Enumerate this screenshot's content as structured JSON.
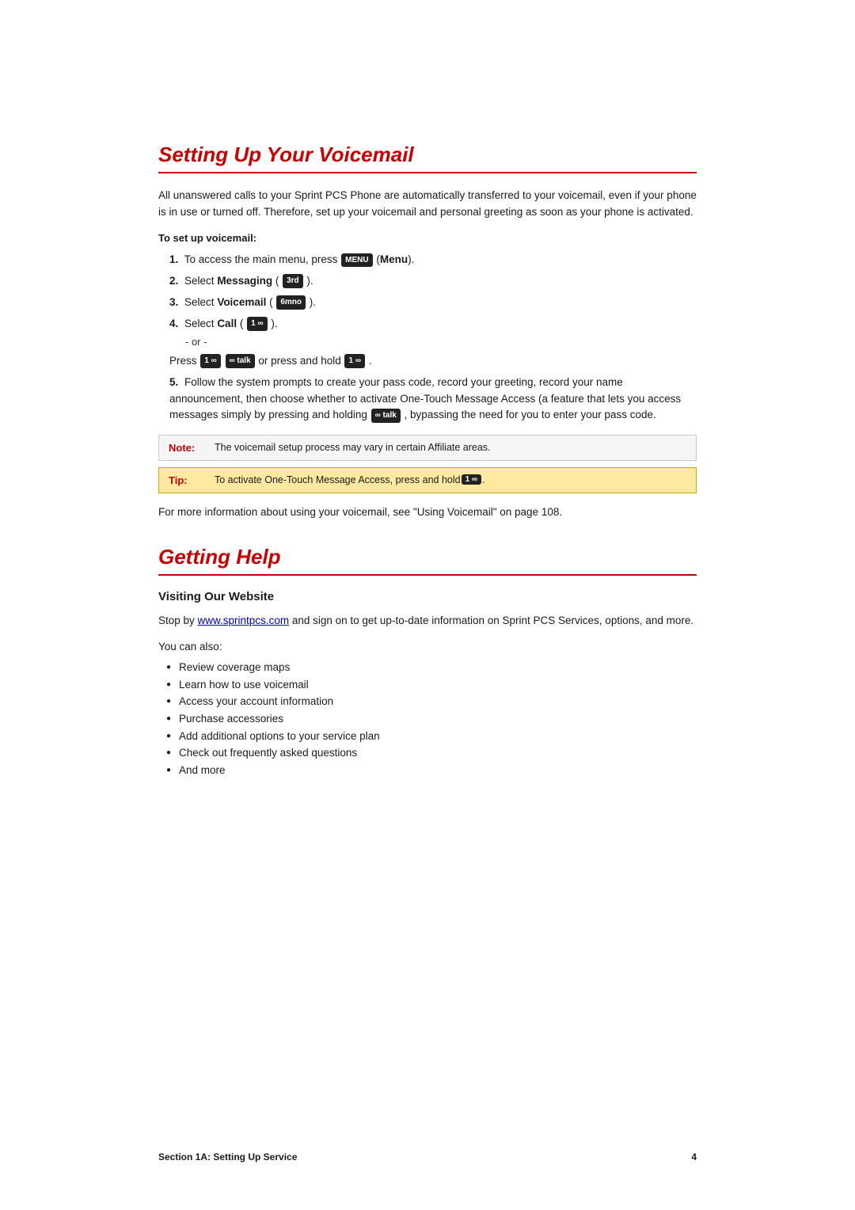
{
  "page": {
    "background": "#ffffff"
  },
  "section1": {
    "title": "Setting Up Your Voicemail",
    "intro_text": "All unanswered calls to your Sprint PCS Phone are automatically transferred to your voicemail, even if your phone is in use or turned off. Therefore, set up your voicemail and personal greeting as soon as your phone is activated.",
    "instruction_label": "To set up voicemail:",
    "steps": [
      {
        "number": "1.",
        "text": "To access the main menu, press",
        "key1": "MENU",
        "key1_label": "Menu",
        "suffix": "."
      },
      {
        "number": "2.",
        "text": "Select",
        "bold": "Messaging",
        "key": "3rd",
        "suffix": "."
      },
      {
        "number": "3.",
        "text": "Select",
        "bold": "Voicemail",
        "key": "6mno",
        "suffix": "."
      },
      {
        "number": "4.",
        "text": "Select",
        "bold": "Call",
        "key": "1 ∞",
        "suffix": "."
      }
    ],
    "or_line": "- or -",
    "press_line": "Press",
    "press_keys": [
      "1 ∞",
      "∞ talk",
      "1 ∞"
    ],
    "press_suffix": "or press and hold",
    "step5_number": "5.",
    "step5_text": "Follow the system prompts to create your pass code, record your greeting, record your name announcement, then choose whether to activate One-Touch Message Access (a feature that lets you access messages simply by pressing and holding",
    "step5_key": "∞ talk",
    "step5_suffix": ", bypassing the need for you to enter your pass code.",
    "note_label": "Note:",
    "note_text": "The voicemail setup process may vary in certain Affiliate areas.",
    "tip_label": "Tip:",
    "tip_text": "To activate One-Touch Message Access, press and hold",
    "tip_key": "1 ∞",
    "tip_suffix": ".",
    "more_info": "For more information about using your voicemail, see \"Using Voicemail\" on page 108."
  },
  "section2": {
    "title": "Getting Help",
    "subsection_title": "Visiting Our Website",
    "website_text_before": "Stop by",
    "website_url": "www.sprintpcs.com",
    "website_text_after": "and sign on to get up-to-date information on Sprint PCS Services, options, and more.",
    "you_can_also": "You can also:",
    "bullet_items": [
      "Review coverage maps",
      "Learn how to use voicemail",
      "Access your account information",
      "Purchase accessories",
      "Add additional options to your service plan",
      "Check out frequently asked questions",
      "And more"
    ]
  },
  "footer": {
    "section_label": "Section 1A: Setting Up Service",
    "page_number": "4"
  }
}
